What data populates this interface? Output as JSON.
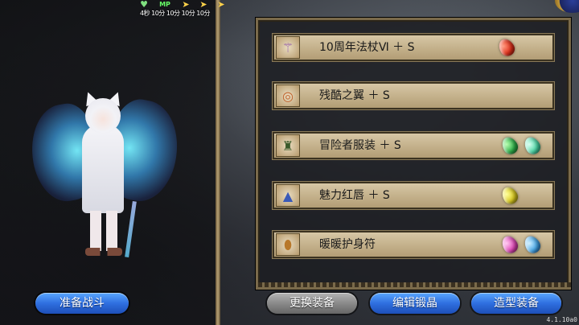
{
  "status": {
    "hp_icon": "heart-icon",
    "mp_label": "MP",
    "text": "4秒 10分 10分 10分 10分"
  },
  "equipment": [
    {
      "name": "10周年法杖Ⅵ ＋ S",
      "icon": "staff-icon",
      "gems": [
        "red"
      ]
    },
    {
      "name": "残酷之翼 ＋ S",
      "icon": "ring-icon",
      "gems": []
    },
    {
      "name": "冒险者服装 ＋ S",
      "icon": "armor-icon",
      "gems": [
        "green",
        "teal"
      ]
    },
    {
      "name": "魅力红唇 ＋ S",
      "icon": "hat-icon",
      "gems": [
        "yellow"
      ]
    },
    {
      "name": "暖暖护身符",
      "icon": "amulet-icon",
      "gems": [
        "pink",
        "blue"
      ]
    }
  ],
  "buttons": {
    "battle": "准备战斗",
    "change": "更换装备",
    "crystal": "编辑锻晶",
    "style": "造型装备"
  },
  "version": "4.1.10a0"
}
